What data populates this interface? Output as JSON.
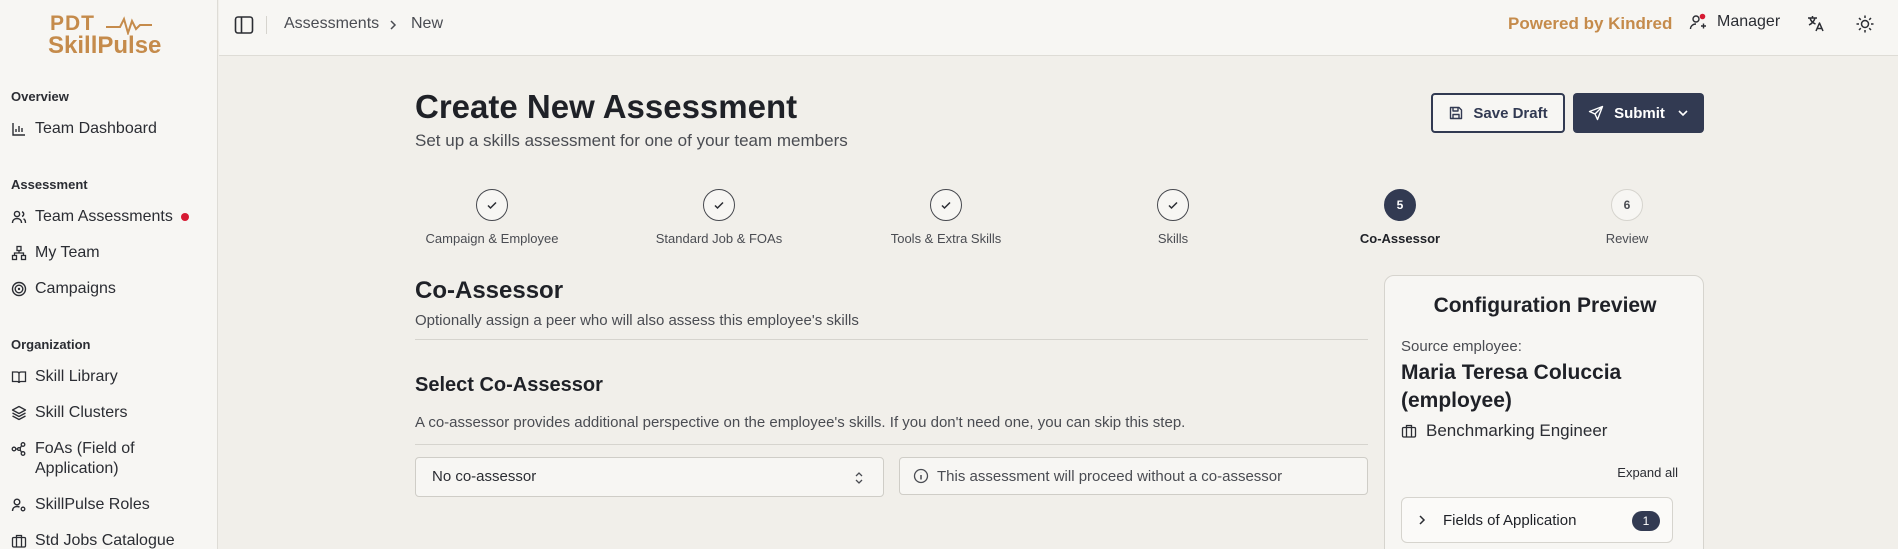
{
  "brand": {
    "line1": "PDT",
    "line2": "SkillPulse"
  },
  "sidebar": {
    "sections": [
      {
        "title": "Overview",
        "items": [
          {
            "label": "Team Dashboard",
            "icon": "bar-chart-icon"
          }
        ]
      },
      {
        "title": "Assessment",
        "items": [
          {
            "label": "Team Assessments",
            "icon": "users-icon",
            "notification": true
          },
          {
            "label": "My Team",
            "icon": "network-icon"
          },
          {
            "label": "Campaigns",
            "icon": "target-icon"
          }
        ]
      },
      {
        "title": "Organization",
        "items": [
          {
            "label": "Skill Library",
            "icon": "book-icon"
          },
          {
            "label": "Skill Clusters",
            "icon": "layers-icon"
          },
          {
            "label": "FoAs (Field of Application)",
            "icon": "share-icon"
          },
          {
            "label": "SkillPulse Roles",
            "icon": "user-cog-icon"
          },
          {
            "label": "Std Jobs Catalogue",
            "icon": "briefcase-icon"
          }
        ]
      }
    ]
  },
  "header": {
    "breadcrumb": [
      "Assessments",
      "New"
    ],
    "powered_by": "Powered by Kindred",
    "role": "Manager"
  },
  "page": {
    "title": "Create New Assessment",
    "subtitle": "Set up a skills assessment for one of your team members",
    "save_draft": "Save Draft",
    "submit": "Submit"
  },
  "stepper": [
    {
      "label": "Campaign & Employee",
      "state": "done"
    },
    {
      "label": "Standard Job & FOAs",
      "state": "done"
    },
    {
      "label": "Tools & Extra Skills",
      "state": "done"
    },
    {
      "label": "Skills",
      "state": "done"
    },
    {
      "label": "Co-Assessor",
      "state": "active",
      "number": "5"
    },
    {
      "label": "Review",
      "state": "future",
      "number": "6"
    }
  ],
  "coassessor": {
    "title": "Co-Assessor",
    "subtitle": "Optionally assign a peer who will also assess this employee's skills",
    "select_title": "Select Co-Assessor",
    "select_desc": "A co-assessor provides additional perspective on the employee's skills. If you don't need one, you can skip this step.",
    "selected": "No co-assessor",
    "info": "This assessment will proceed without a co-assessor"
  },
  "preview": {
    "title": "Configuration Preview",
    "source_label": "Source employee:",
    "source_name": "Maria Teresa Coluccia (employee)",
    "job": "Benchmarking Engineer",
    "expand_all": "Expand all",
    "foa_label": "Fields of Application",
    "foa_count": "1"
  }
}
